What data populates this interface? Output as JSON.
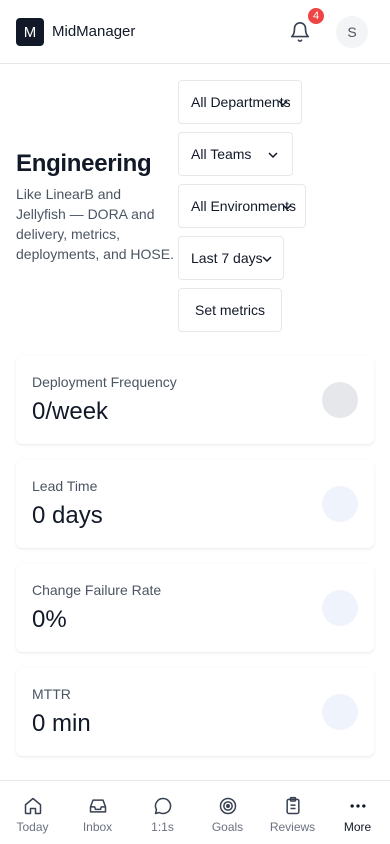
{
  "header": {
    "logo_letter": "M",
    "app_name": "MidManager",
    "notification_count": "4",
    "avatar_initial": "S"
  },
  "page": {
    "title": "Engineering",
    "description": "Like LinearB and Jellyfish — DORA and delivery, metrics, deployments, and HOSE."
  },
  "filters": {
    "department": "All Departments",
    "team": "All Teams",
    "environment": "All Environments",
    "range": "Last 7 days",
    "set_metrics_label": "Set metrics"
  },
  "metrics": [
    {
      "label": "Deployment Frequency",
      "value": "0/week"
    },
    {
      "label": "Lead Time",
      "value": "0 days"
    },
    {
      "label": "Change Failure Rate",
      "value": "0%"
    },
    {
      "label": "MTTR",
      "value": "0 min"
    }
  ],
  "nav": {
    "items": [
      {
        "label": "Today",
        "icon": "home-icon"
      },
      {
        "label": "Inbox",
        "icon": "inbox-icon"
      },
      {
        "label": "1:1s",
        "icon": "chat-bubble-icon"
      },
      {
        "label": "Goals",
        "icon": "target-icon"
      },
      {
        "label": "Reviews",
        "icon": "clipboard-icon"
      },
      {
        "label": "More",
        "icon": "more-horizontal-icon"
      }
    ],
    "active": "More"
  },
  "colors": {
    "badge": "#ef4444",
    "text_primary": "#111827",
    "text_secondary": "#4b5563",
    "border": "#e5e7eb"
  }
}
